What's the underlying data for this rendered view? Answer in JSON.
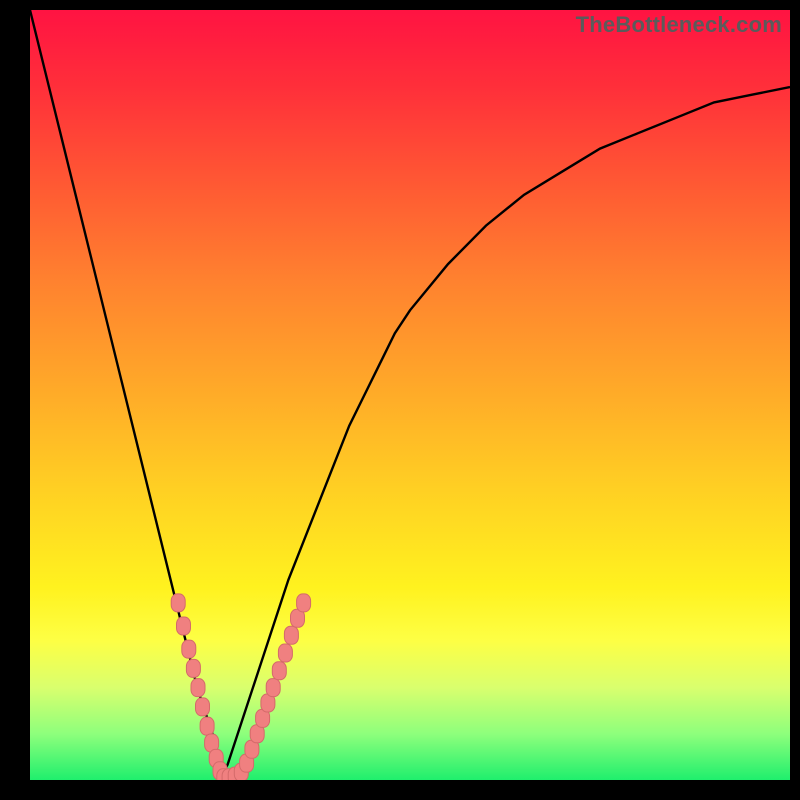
{
  "watermark": "TheBottleneck.com",
  "colors": {
    "frame": "#000000",
    "curve": "#000000",
    "markers_fill": "#f08080",
    "markers_stroke": "#d46a6a"
  },
  "chart_data": {
    "type": "line",
    "title": "",
    "xlabel": "",
    "ylabel": "",
    "xlim": [
      0,
      100
    ],
    "ylim": [
      0,
      100
    ],
    "x": [
      0,
      2,
      4,
      6,
      8,
      10,
      12,
      14,
      16,
      18,
      20,
      22,
      24,
      25,
      26,
      28,
      30,
      32,
      34,
      36,
      38,
      40,
      42,
      44,
      46,
      48,
      50,
      55,
      60,
      65,
      70,
      75,
      80,
      85,
      90,
      95,
      100
    ],
    "y": [
      100,
      92,
      84,
      76,
      68,
      60,
      52,
      44,
      36,
      28,
      20,
      12,
      6,
      0,
      2,
      8,
      14,
      20,
      26,
      31,
      36,
      41,
      46,
      50,
      54,
      58,
      61,
      67,
      72,
      76,
      79,
      82,
      84,
      86,
      88,
      89,
      90
    ],
    "annotations": [],
    "marker_clusters": [
      {
        "side": "left",
        "points": [
          {
            "x": 19.5,
            "y": 23
          },
          {
            "x": 20.2,
            "y": 20
          },
          {
            "x": 20.9,
            "y": 17
          },
          {
            "x": 21.5,
            "y": 14.5
          },
          {
            "x": 22.1,
            "y": 12
          },
          {
            "x": 22.7,
            "y": 9.5
          },
          {
            "x": 23.3,
            "y": 7
          },
          {
            "x": 23.9,
            "y": 4.8
          },
          {
            "x": 24.5,
            "y": 2.8
          },
          {
            "x": 25.0,
            "y": 1.2
          }
        ]
      },
      {
        "side": "bottom",
        "points": [
          {
            "x": 25.5,
            "y": 0.3
          },
          {
            "x": 26.2,
            "y": 0.3
          },
          {
            "x": 27.0,
            "y": 0.5
          },
          {
            "x": 27.8,
            "y": 1.0
          }
        ]
      },
      {
        "side": "right",
        "points": [
          {
            "x": 28.5,
            "y": 2.2
          },
          {
            "x": 29.2,
            "y": 4.0
          },
          {
            "x": 29.9,
            "y": 6.0
          },
          {
            "x": 30.6,
            "y": 8.0
          },
          {
            "x": 31.3,
            "y": 10.0
          },
          {
            "x": 32.0,
            "y": 12.0
          },
          {
            "x": 32.8,
            "y": 14.2
          },
          {
            "x": 33.6,
            "y": 16.5
          },
          {
            "x": 34.4,
            "y": 18.8
          },
          {
            "x": 35.2,
            "y": 21.0
          },
          {
            "x": 36.0,
            "y": 23.0
          }
        ]
      }
    ]
  }
}
